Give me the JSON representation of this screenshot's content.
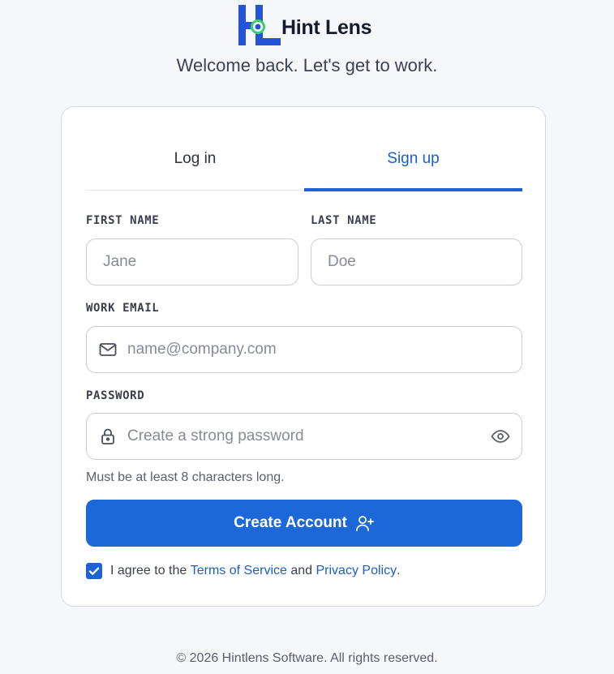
{
  "brand": {
    "name": "Hint Lens",
    "colors": {
      "primary": "#1d63d6",
      "accent_green": "#35d46a"
    }
  },
  "welcome": "Welcome back. Let's get to work.",
  "tabs": [
    {
      "label": "Log in",
      "active": false
    },
    {
      "label": "Sign up",
      "active": true
    }
  ],
  "form": {
    "first_name": {
      "label": "FIRST NAME",
      "placeholder": "Jane",
      "value": ""
    },
    "last_name": {
      "label": "LAST NAME",
      "placeholder": "Doe",
      "value": ""
    },
    "email": {
      "label": "WORK EMAIL",
      "placeholder": "name@company.com",
      "value": "",
      "icon": "mail-icon"
    },
    "password": {
      "label": "PASSWORD",
      "placeholder": "Create a strong password",
      "value": "",
      "icon": "lock-icon",
      "toggle_icon": "eye-icon"
    },
    "password_hint": "Must be at least 8 characters long.",
    "submit_label": "Create Account",
    "submit_icon": "user-plus-icon",
    "agree": {
      "checked": true,
      "prefix": "I agree to the",
      "terms": "Terms of Service",
      "and": "and",
      "privacy": "Privacy Policy",
      "suffix": "."
    }
  },
  "footer": "© 2026 Hintlens Software. All rights reserved."
}
